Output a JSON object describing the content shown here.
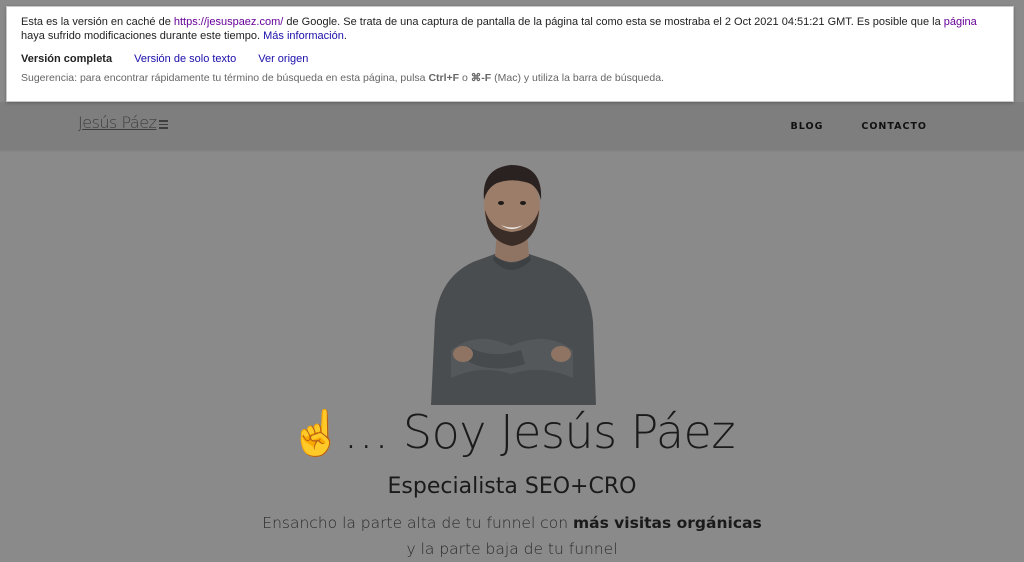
{
  "cache_banner": {
    "line1_prefix": "Esta es la versión en caché de ",
    "cached_url": "https://jesuspaez.com/",
    "line1_mid": " de Google. Se trata de una captura de pantalla de la página tal como esta se mostraba el 2 Oct 2021 04:51:21 GMT. Es posible que la ",
    "page_link": "página",
    "line1_suffix": " haya sufrido modificaciones durante este tiempo. ",
    "more_info_link": "Más información",
    "more_info_suffix": ".",
    "tabs": [
      {
        "label": "Versión completa"
      },
      {
        "label": "Versión de solo texto"
      },
      {
        "label": "Ver origen"
      }
    ],
    "hint_prefix": "Sugerencia: para encontrar rápidamente tu término de búsqueda en esta página, pulsa ",
    "hint_key1": "Ctrl+F",
    "hint_mid": " o ",
    "hint_key2": "⌘-F",
    "hint_suffix": " (Mac) y utiliza la barra de búsqueda."
  },
  "header": {
    "logo_text": "Jesús Páez",
    "nav": [
      {
        "label": "BLOG"
      },
      {
        "label": "CONTACTO"
      }
    ]
  },
  "hero": {
    "emoji": "☝️",
    "title": "… Soy Jesús Páez",
    "subtitle": "Especialista SEO+CRO",
    "body_part1": "Ensancho la parte alta de tu funnel con ",
    "body_bold": "más visitas orgánicas",
    "body_part2": " y la parte baja de tu funnel"
  }
}
